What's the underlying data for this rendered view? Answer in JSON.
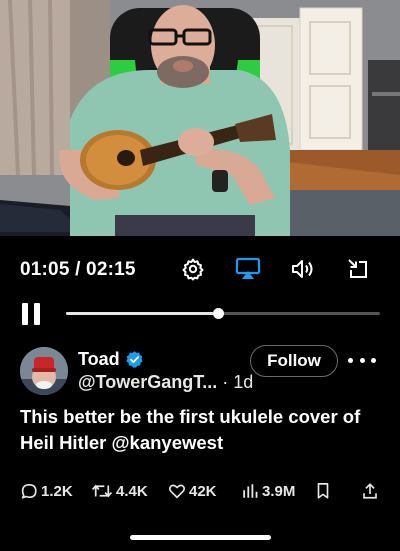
{
  "player": {
    "current_time": "01:05",
    "duration": "02:15",
    "time_separator": " / ",
    "progress": 0.483,
    "icons": {
      "settings": "gear-icon",
      "airplay": "airplay-icon",
      "volume": "speaker-icon",
      "exit_fullscreen": "minimize-icon",
      "pause": "pause-icon"
    },
    "accent": "#1d9bf0"
  },
  "tweet": {
    "display_name": "Toad",
    "handle": "@TowerGangT...",
    "meta": " · 1d",
    "follow_label": "Follow",
    "text_before": "This better be the first ukulele cover of Heil Hitler ",
    "mention": "@kanyewest",
    "replies": "1.2K",
    "reposts": "4.4K",
    "likes": "42K",
    "views": "3.9M",
    "verified_color": "#1d9bf0"
  }
}
